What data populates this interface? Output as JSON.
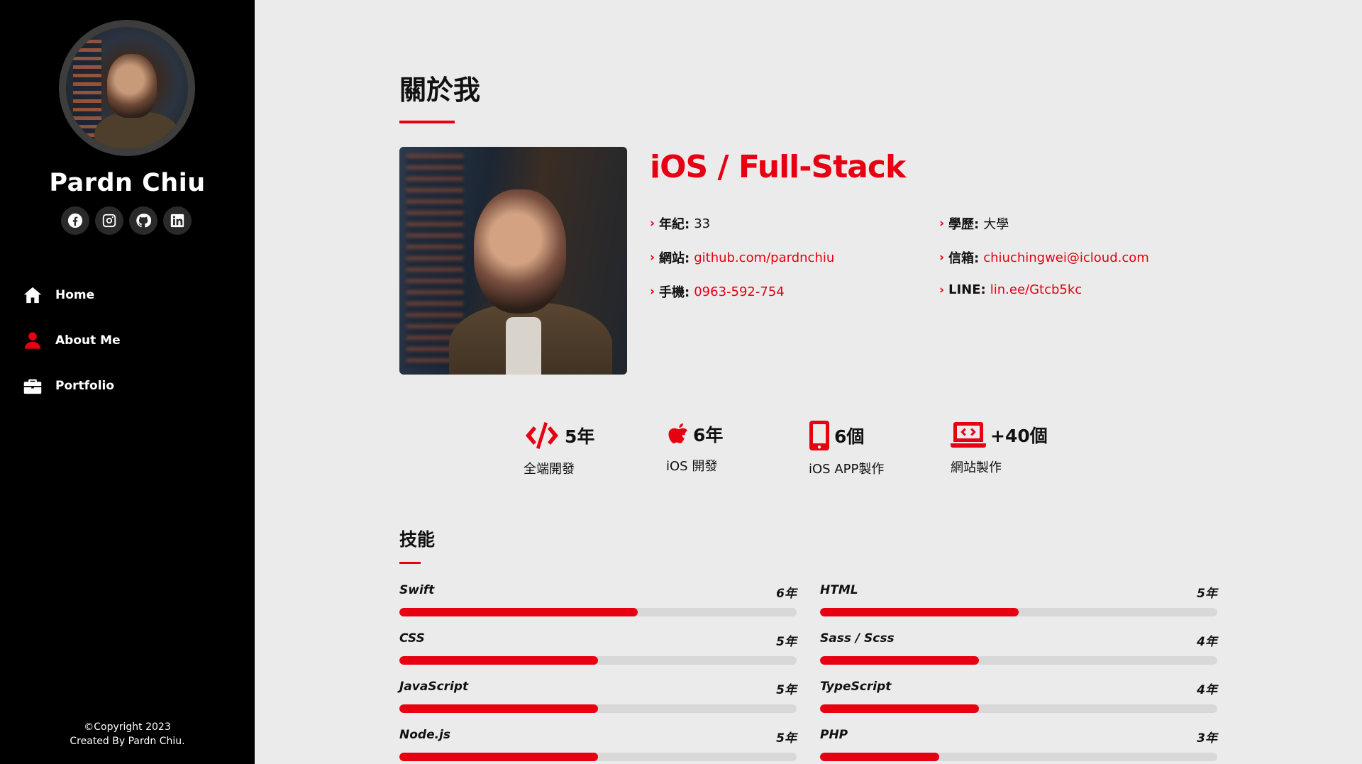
{
  "sidebar": {
    "name": "Pardn Chiu",
    "socials": [
      "facebook-icon",
      "instagram-icon",
      "github-icon",
      "linkedin-icon"
    ],
    "nav": [
      {
        "label": "Home",
        "icon": "home-icon"
      },
      {
        "label": "About Me",
        "icon": "user-icon"
      },
      {
        "label": "Portfolio",
        "icon": "briefcase-icon"
      }
    ],
    "copyright_line1": "©Copyright 2023",
    "copyright_line2": "Created By Pardn Chiu."
  },
  "about": {
    "title": "關於我",
    "role": "iOS / Full-Stack",
    "info": [
      {
        "label": "年紀:",
        "value": "33",
        "link": false
      },
      {
        "label": "學歷:",
        "value": "大學",
        "link": false
      },
      {
        "label": "網站:",
        "value": "github.com/pardnchiu",
        "link": true
      },
      {
        "label": "信箱:",
        "value": "chiuchingwei@icloud.com",
        "link": true
      },
      {
        "label": "手機:",
        "value": "0963-592-754",
        "link": true
      },
      {
        "label": "LINE:",
        "value": "lin.ee/Gtcb5kc",
        "link": true
      }
    ]
  },
  "stats": [
    {
      "icon": "code-icon",
      "num": "5年",
      "caption": "全端開發"
    },
    {
      "icon": "apple-icon",
      "num": "6年",
      "caption": "iOS 開發"
    },
    {
      "icon": "mobile-icon",
      "num": "6個",
      "caption": "iOS APP製作"
    },
    {
      "icon": "laptop-code-icon",
      "num": "+40個",
      "caption": "網站製作"
    }
  ],
  "skills": {
    "title": "技能",
    "items": [
      {
        "name": "Swift",
        "years": "6年",
        "level": 0.6
      },
      {
        "name": "HTML",
        "years": "5年",
        "level": 0.5
      },
      {
        "name": "CSS",
        "years": "5年",
        "level": 0.5
      },
      {
        "name": "Sass / Scss",
        "years": "4年",
        "level": 0.4
      },
      {
        "name": "JavaScript",
        "years": "5年",
        "level": 0.5
      },
      {
        "name": "TypeScript",
        "years": "4年",
        "level": 0.4
      },
      {
        "name": "Node.js",
        "years": "5年",
        "level": 0.5
      },
      {
        "name": "PHP",
        "years": "3年",
        "level": 0.3
      }
    ]
  },
  "colors": {
    "accent": "#e60012",
    "sidebar": "#000000",
    "background": "#ebebeb"
  }
}
